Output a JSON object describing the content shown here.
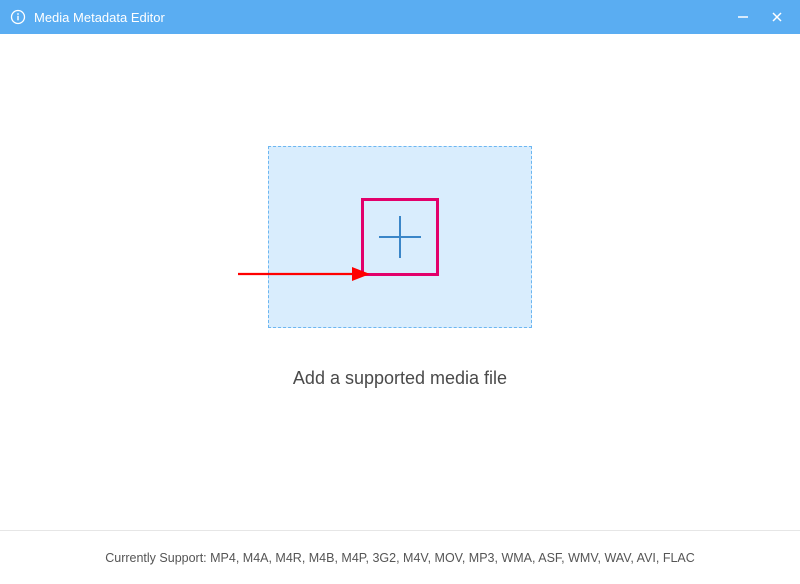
{
  "titlebar": {
    "title": "Media Metadata Editor"
  },
  "main": {
    "caption": "Add a supported media file"
  },
  "footer": {
    "label": "Currently Support: ",
    "formats": "MP4, M4A, M4R, M4B, M4P, 3G2, M4V, MOV, MP3, WMA, ASF, WMV, WAV, AVI, FLAC"
  }
}
